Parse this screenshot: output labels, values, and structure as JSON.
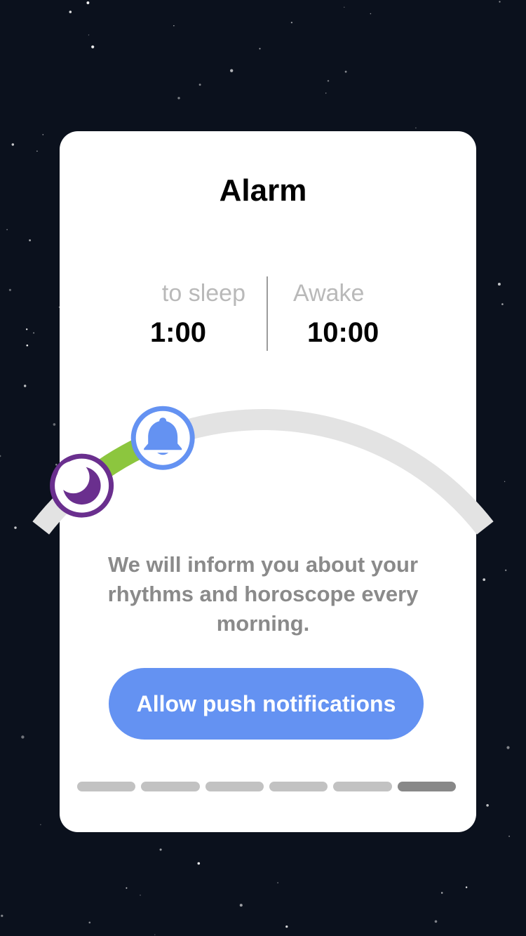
{
  "title": "Alarm",
  "sleep": {
    "label": "to sleep",
    "value": "1:00"
  },
  "wake": {
    "label": "Awake",
    "value": "10:00"
  },
  "dial": {
    "sleep_icon": "moon-icon",
    "wake_icon": "bell-icon",
    "progress_fraction": 0.3,
    "colors": {
      "track": "#e3e3e3",
      "progress": "#8cc63e",
      "sleep_knob": "#6a2f8e",
      "wake_knob": "#6492f2"
    }
  },
  "message": "We will inform you about your rhythms and horoscope every morning.",
  "cta_label": "Allow push notifications",
  "pager": {
    "count": 6,
    "active_index": 5
  },
  "colors": {
    "background": "#0b111d",
    "card": "#ffffff",
    "accent": "#6492f2"
  }
}
